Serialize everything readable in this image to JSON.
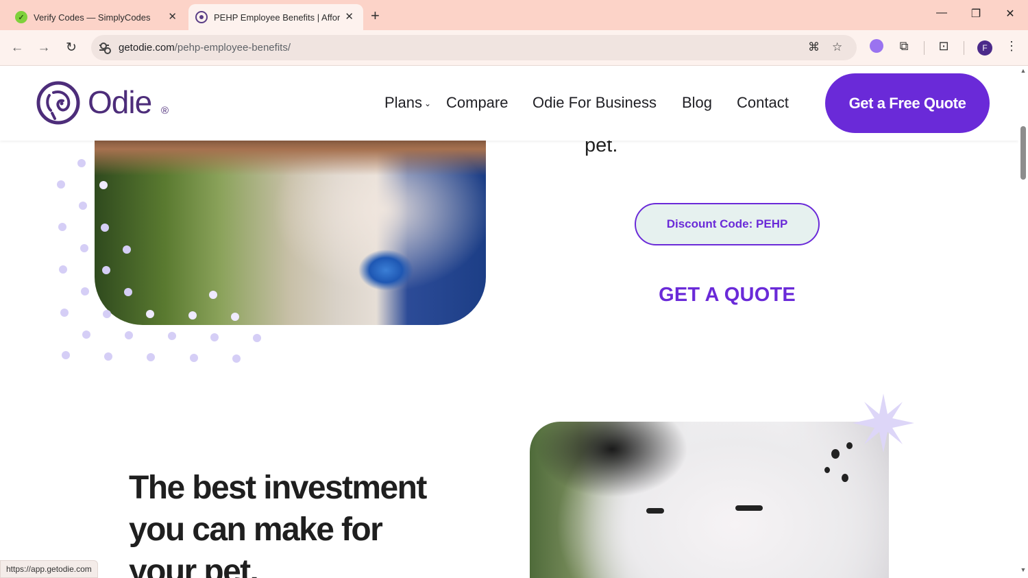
{
  "browser": {
    "tabs": [
      {
        "title": "Verify Codes — SimplyCodes",
        "active": false,
        "favicon": "simplycodes-favicon"
      },
      {
        "title": "PEHP Employee Benefits | Affordab",
        "active": true,
        "favicon": "odie-favicon"
      }
    ],
    "new_tab_label": "+",
    "address": {
      "domain": "getodie.com",
      "path": "/pehp-employee-benefits/"
    },
    "profile_initial": "F",
    "colors": {
      "tabbar": "#fcd3c8",
      "toolbar": "#fdf2ee"
    }
  },
  "site": {
    "logo_text": "Odie",
    "logo_reg": "®",
    "nav": [
      "Plans",
      "Compare",
      "Odie For Business",
      "Blog",
      "Contact"
    ],
    "cta": "Get a Free Quote",
    "brand_color": "#6a2ad8"
  },
  "hero": {
    "pet_text": "pet.",
    "discount_label": "Discount Code: PEHP",
    "quote_link": "GET A QUOTE"
  },
  "section2": {
    "headline": "The best investment you can make for your pet."
  },
  "status_url": "https://app.getodie.com"
}
